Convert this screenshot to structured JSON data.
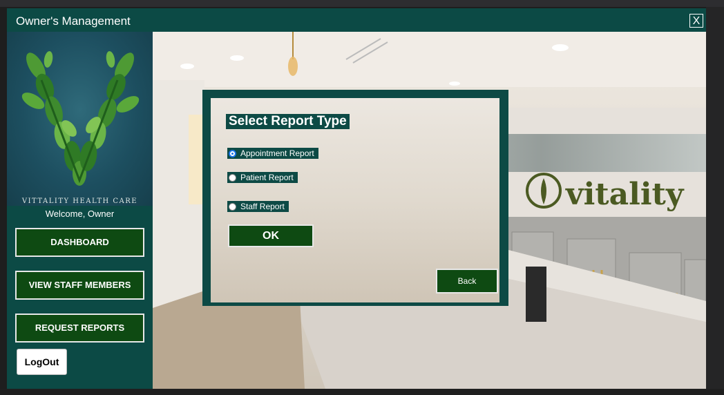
{
  "window": {
    "title": "Owner's Management",
    "close_label": "X"
  },
  "sidebar": {
    "logo_text": "VITTALITY HEALTH CARE",
    "welcome": "Welcome, Owner",
    "buttons": [
      {
        "label": "DASHBOARD"
      },
      {
        "label": "VIEW STAFF MEMBERS"
      },
      {
        "label": "REQUEST REPORTS"
      }
    ],
    "logout_label": "LogOut"
  },
  "background": {
    "sign_text": "vitality"
  },
  "dialog": {
    "title": "Select Report Type",
    "options": [
      {
        "label": "Appointment Report",
        "checked": true
      },
      {
        "label": "Patient Report",
        "checked": false
      },
      {
        "label": "Staff Report",
        "checked": false
      }
    ],
    "ok_label": "OK",
    "back_label": "Back"
  },
  "colors": {
    "window_bg": "#0c4a45",
    "button_bg": "#0e4a12",
    "button_border": "#e8e8e8"
  }
}
